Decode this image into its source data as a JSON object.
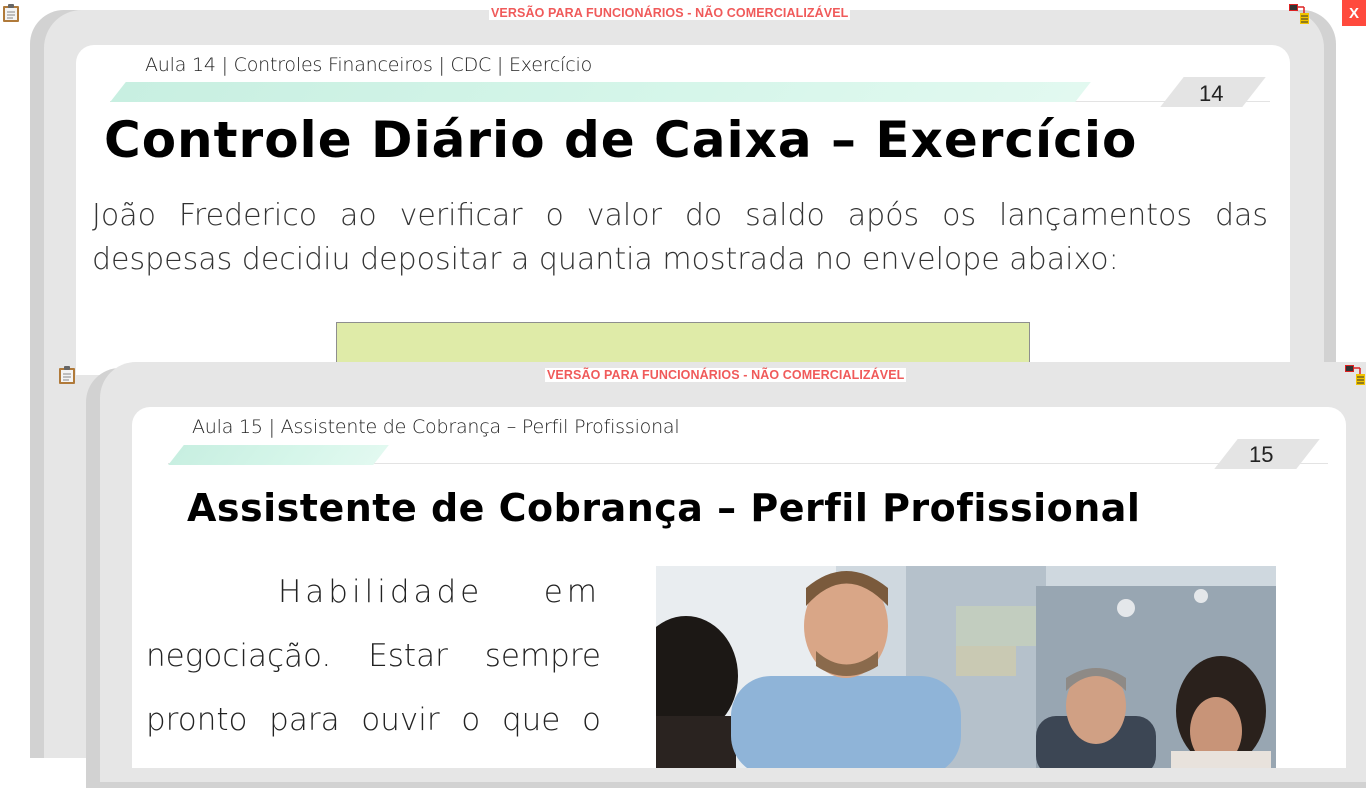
{
  "window_back": {
    "watermark": "VERSÃO PARA FUNCIONÁRIOS - NÃO COMERCIALIZÁVEL",
    "close_label": "X",
    "breadcrumb": "Aula 14 | Controles Financeiros | CDC | Exercício",
    "page_number": "14",
    "title": "Controle Diário de Caixa – Exercício",
    "paragraph": "João Frederico ao verificar o valor do saldo após os lançamentos das despesas decidiu depositar a quantia mostrada no envelope abaixo:"
  },
  "window_front": {
    "watermark": "VERSÃO PARA FUNCIONÁRIOS - NÃO COMERCIALIZÁVEL",
    "breadcrumb": "Aula 15 | Assistente de Cobrança – Perfil Profissional",
    "page_number": "15",
    "title": "Assistente de Cobrança – Perfil Profissional",
    "lines": [
      "Habilidade em",
      "negociação. Estar sempre",
      "pronto para ouvir o que o"
    ]
  },
  "colors": {
    "watermark": "#f05a5a",
    "close_button": "#ff4a3d",
    "band": "#c8efe1",
    "envelope": "#dfeba8",
    "frame": "#e6e6e6"
  },
  "icons": [
    "clipboard-icon",
    "network-icon"
  ]
}
